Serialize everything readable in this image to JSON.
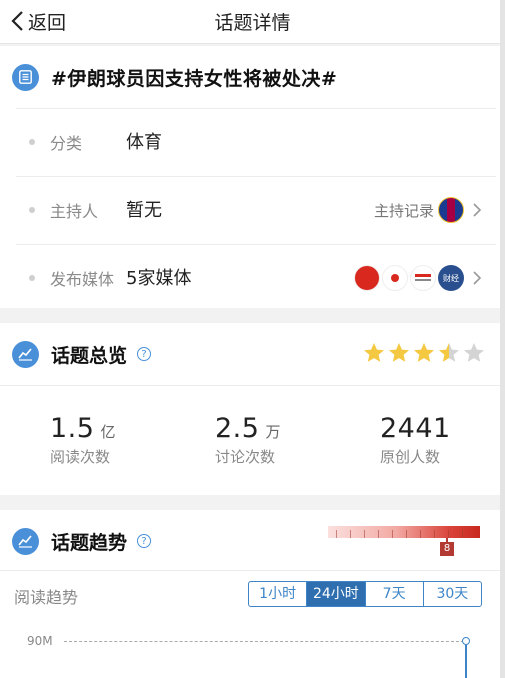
{
  "nav": {
    "back_label": "返回",
    "title": "话题详情"
  },
  "topic": {
    "title": "#伊朗球员因支持女性将被处决#",
    "rows": [
      {
        "label": "分类",
        "value": "体育"
      },
      {
        "label": "主持人",
        "value": "暂无",
        "link": "主持记录"
      },
      {
        "label": "发布媒体",
        "value": "5家媒体",
        "badge_text": "财经"
      }
    ]
  },
  "overview": {
    "title": "话题总览",
    "help": "?",
    "rating": 3.5,
    "stats": [
      {
        "num": "1.5",
        "unit": "亿",
        "caption": "阅读次数"
      },
      {
        "num": "2.5",
        "unit": "万",
        "caption": "讨论次数"
      },
      {
        "num": "2441",
        "unit": "",
        "caption": "原创人数"
      }
    ]
  },
  "trend": {
    "title": "话题趋势",
    "help": "?",
    "heat_level": "8",
    "reading_label": "阅读趋势",
    "ranges": [
      "1小时",
      "24小时",
      "7天",
      "30天"
    ],
    "active_range": "24小时",
    "y_tick": "90M"
  },
  "colors": {
    "accent": "#3d85c6",
    "heat": "#c8281e",
    "star": "#f5c842"
  }
}
